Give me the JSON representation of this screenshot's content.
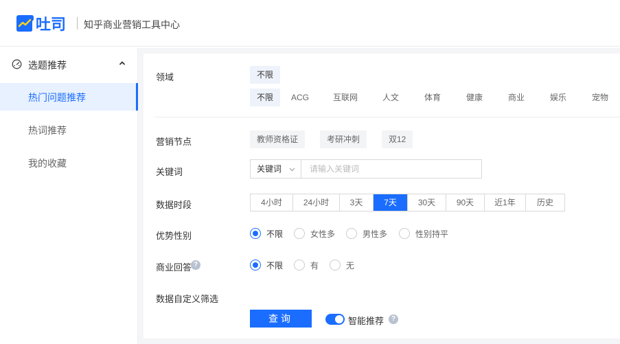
{
  "header": {
    "logo_text": "吐司",
    "subtitle": "知乎商业营销工具中心"
  },
  "sidebar": {
    "group_label": "选题推荐",
    "items": [
      {
        "label": "热门问题推荐",
        "active": true
      },
      {
        "label": "热词推荐",
        "active": false
      },
      {
        "label": "我的收藏",
        "active": false
      }
    ]
  },
  "filters": {
    "domain_label": "领域",
    "domain_selected": "不限",
    "domain_options": [
      "不限",
      "ACG",
      "互联网",
      "人文",
      "体育",
      "健康",
      "商业",
      "娱乐",
      "宠物"
    ],
    "node_label": "营销节点",
    "node_options": [
      "教师资格证",
      "考研冲刺",
      "双12"
    ],
    "keyword_label": "关键词",
    "keyword_type": "关键词",
    "keyword_placeholder": "请输入关键词",
    "period_label": "数据时段",
    "period_options": [
      "4小时",
      "24小时",
      "3天",
      "7天",
      "30天",
      "90天",
      "近1年",
      "历史"
    ],
    "period_selected": "7天",
    "gender_label": "优势性别",
    "gender_options": [
      "不限",
      "女性多",
      "男性多",
      "性别持平"
    ],
    "gender_selected": "不限",
    "business_label": "商业回答",
    "business_options": [
      "不限",
      "有",
      "无"
    ],
    "business_selected": "不限",
    "custom_label": "数据自定义筛选",
    "query_button": "查询",
    "smart_label": "智能推荐",
    "smart_on": true
  },
  "colors": {
    "accent": "#1a6dff",
    "sidebar_active_bg": "#e8f1ff"
  }
}
